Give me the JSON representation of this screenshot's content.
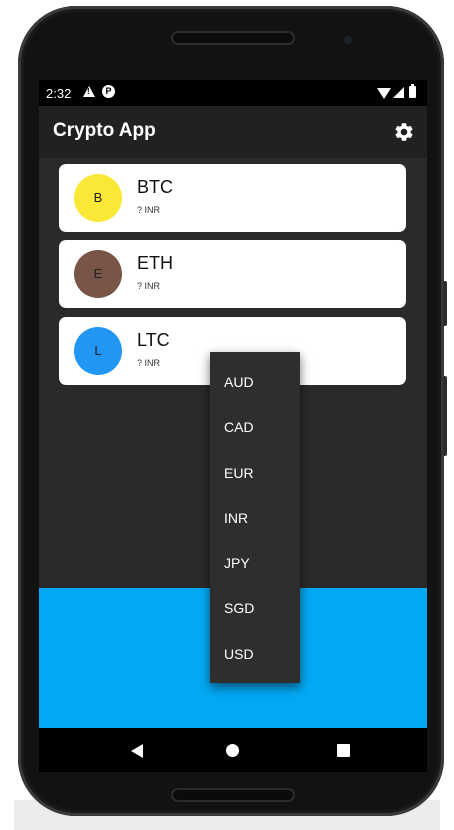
{
  "status_bar": {
    "time": "2:32"
  },
  "app_bar": {
    "title": "Crypto App",
    "settings_icon": "gear-icon"
  },
  "coins": [
    {
      "initial": "B",
      "symbol": "BTC",
      "price": "? INR",
      "color": "#fbe735"
    },
    {
      "initial": "E",
      "symbol": "ETH",
      "price": "? INR",
      "color": "#795548"
    },
    {
      "initial": "L",
      "symbol": "LTC",
      "price": "? INR",
      "color": "#2196f3"
    }
  ],
  "currency_menu": {
    "options": [
      "AUD",
      "CAD",
      "EUR",
      "INR",
      "JPY",
      "SGD",
      "USD"
    ]
  },
  "colors": {
    "background": "#2a2a2a",
    "app_bar": "#212121",
    "card": "#ffffff",
    "bottom_panel": "#03a9f4",
    "menu": "#2e2e2e"
  }
}
